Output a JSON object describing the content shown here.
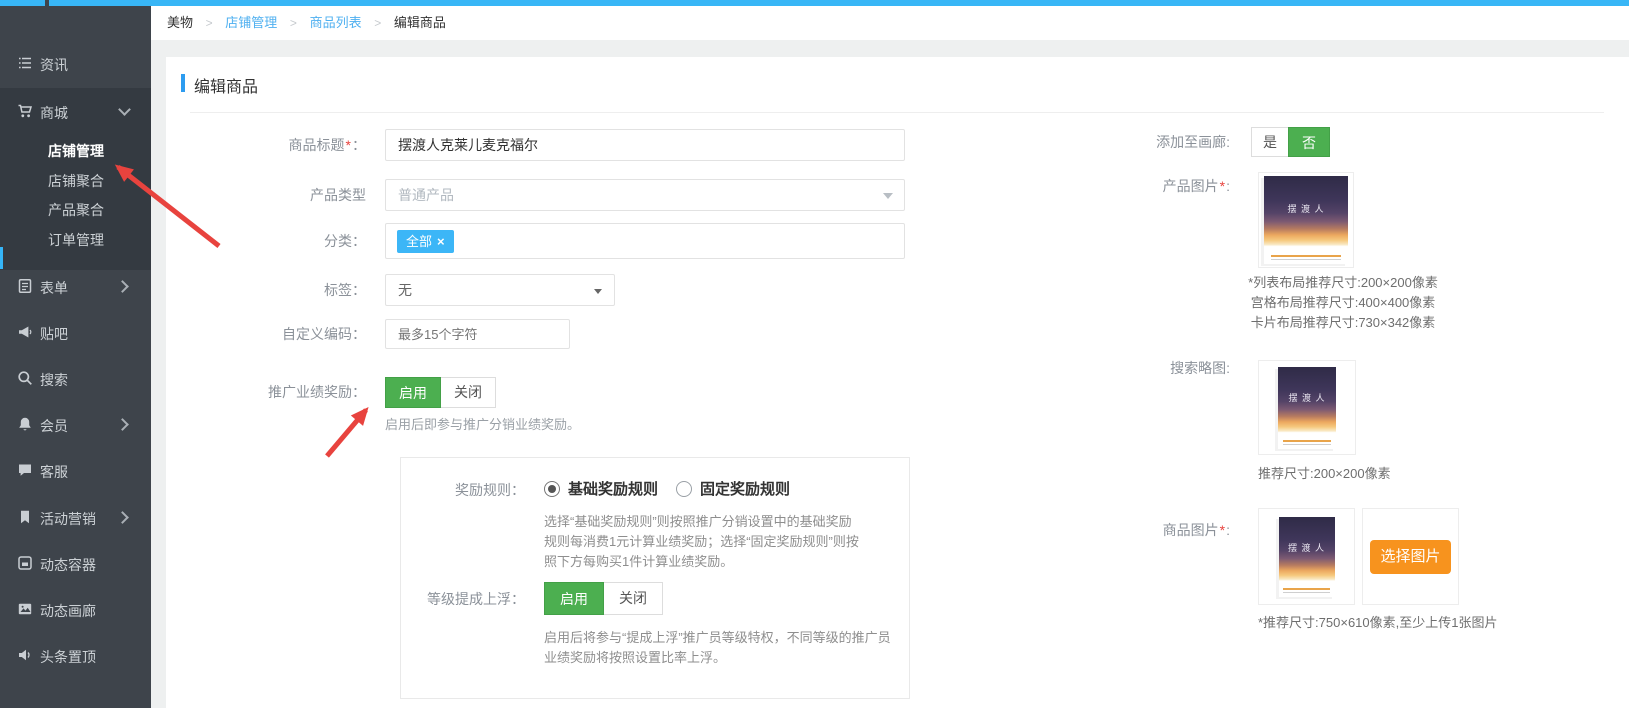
{
  "ui": {
    "asterisk": "*",
    "colon_full": "：",
    "colon_half": ":",
    "breadcrumb_sep": ">"
  },
  "colors": {
    "topbar_blue": "#38b6f6",
    "link_blue": "#4fb0f0",
    "accent_blue": "#2d9cf0",
    "tag_blue": "#3cb6f7",
    "green": "#4caf50",
    "orange": "#f7931e",
    "arrow_red": "#e8433e",
    "sidebar_dark": "#3e444b"
  },
  "sidebar": {
    "items": [
      {
        "label": "资讯",
        "icon": "list-icon"
      },
      {
        "label": "商城",
        "icon": "cart-icon"
      },
      {
        "label": "表单",
        "icon": "form-icon"
      },
      {
        "label": "贴吧",
        "icon": "megaphone-icon"
      },
      {
        "label": "搜索",
        "icon": "search-icon"
      },
      {
        "label": "会员",
        "icon": "bell-icon"
      },
      {
        "label": "客服",
        "icon": "chat-icon"
      },
      {
        "label": "活动营销",
        "icon": "bookmark-icon"
      },
      {
        "label": "动态容器",
        "icon": "container-icon"
      },
      {
        "label": "动态画廊",
        "icon": "gallery-icon"
      },
      {
        "label": "头条置顶",
        "icon": "speaker-icon"
      }
    ],
    "mall_children": [
      {
        "label": "店铺管理"
      },
      {
        "label": "店铺聚合"
      },
      {
        "label": "产品聚合"
      },
      {
        "label": "订单管理"
      }
    ]
  },
  "breadcrumb": [
    {
      "label": "美物"
    },
    {
      "label": "店铺管理"
    },
    {
      "label": "商品列表"
    },
    {
      "label": "编辑商品"
    }
  ],
  "page": {
    "title": "编辑商品"
  },
  "form": {
    "title": {
      "label": "商品标题",
      "value": "摆渡人克莱儿麦克福尔"
    },
    "product_type": {
      "label": "产品类型",
      "value": "普通产品"
    },
    "category": {
      "label": "分类",
      "tag": "全部",
      "remove": "×"
    },
    "tag": {
      "label": "标签",
      "value": "无"
    },
    "custom_code": {
      "label": "自定义编码",
      "placeholder": "最多15个字符"
    },
    "promo_reward": {
      "label": "推广业绩奖励",
      "on": "启用",
      "off": "关闭",
      "help": "启用后即参与推广分销业绩奖励。"
    },
    "reward_panel": {
      "rule": {
        "label": "奖励规则",
        "option_basic": "基础奖励规则",
        "option_fixed": "固定奖励规则",
        "desc": "选择“基础奖励规则”则按照推广分销设置中的基础奖励规则每消费1元计算业绩奖励；选择“固定奖励规则”则按照下方每购买1件计算业绩奖励。"
      },
      "level": {
        "label": "等级提成上浮",
        "on": "启用",
        "off": "关闭",
        "desc": "启用后将参与“提成上浮”推广员等级特权，不同等级的推广员业绩奖励将按照设置比率上浮。"
      }
    }
  },
  "right_panel": {
    "gallery": {
      "label": "添加至画廊",
      "yes": "是",
      "no": "否"
    },
    "product_image": {
      "label": "产品图片",
      "hints": [
        "*列表布局推荐尺寸:200×200像素",
        "宫格布局推荐尺寸:400×400像素",
        "卡片布局推荐尺寸:730×342像素"
      ]
    },
    "search_thumb": {
      "label": "搜索略图",
      "hint": "推荐尺寸:200×200像素"
    },
    "goods_image": {
      "label": "商品图片",
      "button": "选择图片",
      "hint": "*推荐尺寸:750×610像素,至少上传1张图片"
    }
  },
  "book": {
    "title": "摆 渡 人"
  }
}
